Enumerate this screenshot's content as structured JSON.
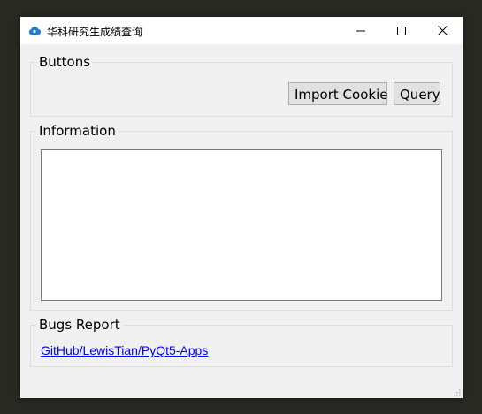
{
  "window": {
    "title": "华科研究生成绩查询",
    "icon": "cloud-icon",
    "controls": [
      "minimize-icon",
      "maximize-icon",
      "close-icon"
    ]
  },
  "buttons_group": {
    "title": "Buttons",
    "import_cookie_label": "Import Cookie",
    "query_label": "Query"
  },
  "information_group": {
    "title": "Information",
    "content": ""
  },
  "bugs_group": {
    "title": "Bugs Report",
    "link_text": "GitHub/LewisTian/PyQt5-Apps"
  },
  "colors": {
    "accent": "#1e7fd2",
    "link": "#0000ff",
    "background": "#f0f0f0"
  }
}
